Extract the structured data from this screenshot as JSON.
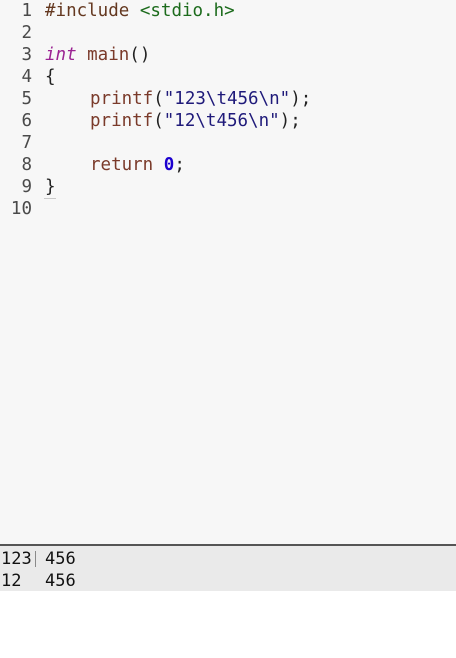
{
  "editor": {
    "lines": [
      {
        "num": "1",
        "parts": {
          "a": "#include",
          "b": " <stdio.h>"
        }
      },
      {
        "num": "2"
      },
      {
        "num": "3",
        "parts": {
          "kw": "int",
          "fn": " main",
          "rest": "()"
        }
      },
      {
        "num": "4",
        "parts": {
          "text": "{"
        }
      },
      {
        "num": "5",
        "parts": {
          "fn": "printf",
          "open": "(",
          "str": "\"123\\t456\\n\"",
          "close": ");"
        }
      },
      {
        "num": "6",
        "parts": {
          "fn": "printf",
          "open": "(",
          "str": "\"12\\t456\\n\"",
          "close": ");"
        }
      },
      {
        "num": "7"
      },
      {
        "num": "8",
        "parts": {
          "ret": "return",
          "num": "0",
          "semi": ";"
        }
      },
      {
        "num": "9",
        "parts": {
          "text": "}"
        }
      },
      {
        "num": "10"
      }
    ],
    "active_line": "6"
  },
  "console": {
    "output": [
      {
        "a": "123",
        "b": "456"
      },
      {
        "a": "12",
        "b": "456"
      }
    ]
  }
}
